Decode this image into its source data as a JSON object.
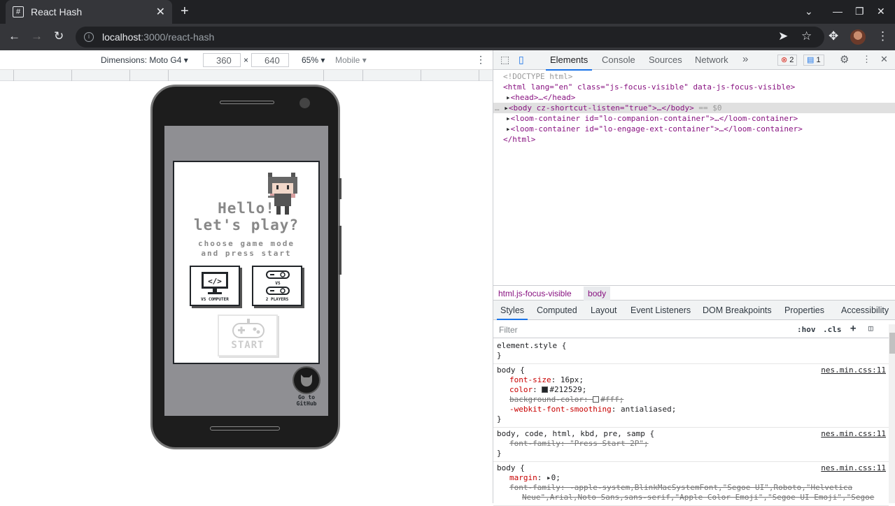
{
  "browser": {
    "tab_title": "React Hash",
    "favicon": "#",
    "url_host": "localhost",
    "url_path": ":3000/react-hash"
  },
  "device_toolbar": {
    "dimensions_label": "Dimensions: Moto G4",
    "width": "360",
    "times": "×",
    "height": "640",
    "zoom": "65%",
    "mode": "Mobile"
  },
  "app": {
    "hello_line1": "Hello!",
    "hello_line2": "let's play?",
    "sub_line1": "choose game mode",
    "sub_line2": "and press start",
    "mode_vs_computer": "VS COMPUTER",
    "mode_2_players": "2 PLAYERS",
    "vs_small": "VS",
    "start": "START",
    "github_line1": "Go to",
    "github_line2": "GitHub"
  },
  "devtools": {
    "tabs": [
      "Elements",
      "Console",
      "Sources",
      "Network"
    ],
    "more": "»",
    "errors": "2",
    "messages": "1",
    "dom": {
      "doctype": "<!DOCTYPE html>",
      "html_open": "<html lang=\"en\" class=\"js-focus-visible\" data-js-focus-visible>",
      "head": "<head>…</head>",
      "body": "<body cz-shortcut-listen=\"true\">…</body>",
      "body_suffix": "== $0",
      "loom1": "<loom-container id=\"lo-companion-container\">…</loom-container>",
      "loom2": "<loom-container id=\"lo-engage-ext-container\">…</loom-container>",
      "html_close": "</html>"
    },
    "breadcrumbs": [
      "html.js-focus-visible",
      "body"
    ],
    "style_tabs": [
      "Styles",
      "Computed",
      "Layout",
      "Event Listeners",
      "DOM Breakpoints",
      "Properties",
      "Accessibility"
    ],
    "filter_placeholder": "Filter",
    "hov": ":hov",
    "cls": ".cls",
    "rules": {
      "r0_selector": "element.style {",
      "close": "}",
      "r1_selector": "body {",
      "r1_src": "nes.min.css:11",
      "r1_p1_name": "font-size",
      "r1_p1_val": "16px;",
      "r1_p2_name": "color",
      "r1_p2_val": "#212529;",
      "r1_p3": "background-color:",
      "r1_p3_val": "#fff;",
      "r1_p4_name": "-webkit-font-smoothing",
      "r1_p4_val": "antialiased;",
      "r2_selector": "body, code, html, kbd, pre, samp {",
      "r2_src": "nes.min.css:11",
      "r2_p1": "font-family: \"Press Start 2P\";",
      "r3_selector": "body {",
      "r3_src": "nes.min.css:11",
      "r3_p1_name": "margin",
      "r3_p1_val": "0;",
      "r3_p2": "font-family: -apple-system,BlinkMacSystemFont,\"Segoe UI\",Roboto,\"Helvetica",
      "r3_p3": "Neue\",Arial,Noto Sans,sans-serif,\"Apple Color Emoji\",\"Segoe UI Emoji\",\"Segoe"
    }
  },
  "colors": {
    "accent": "#1a73e8",
    "chrome_dark": "#202124",
    "error": "#d93025"
  }
}
